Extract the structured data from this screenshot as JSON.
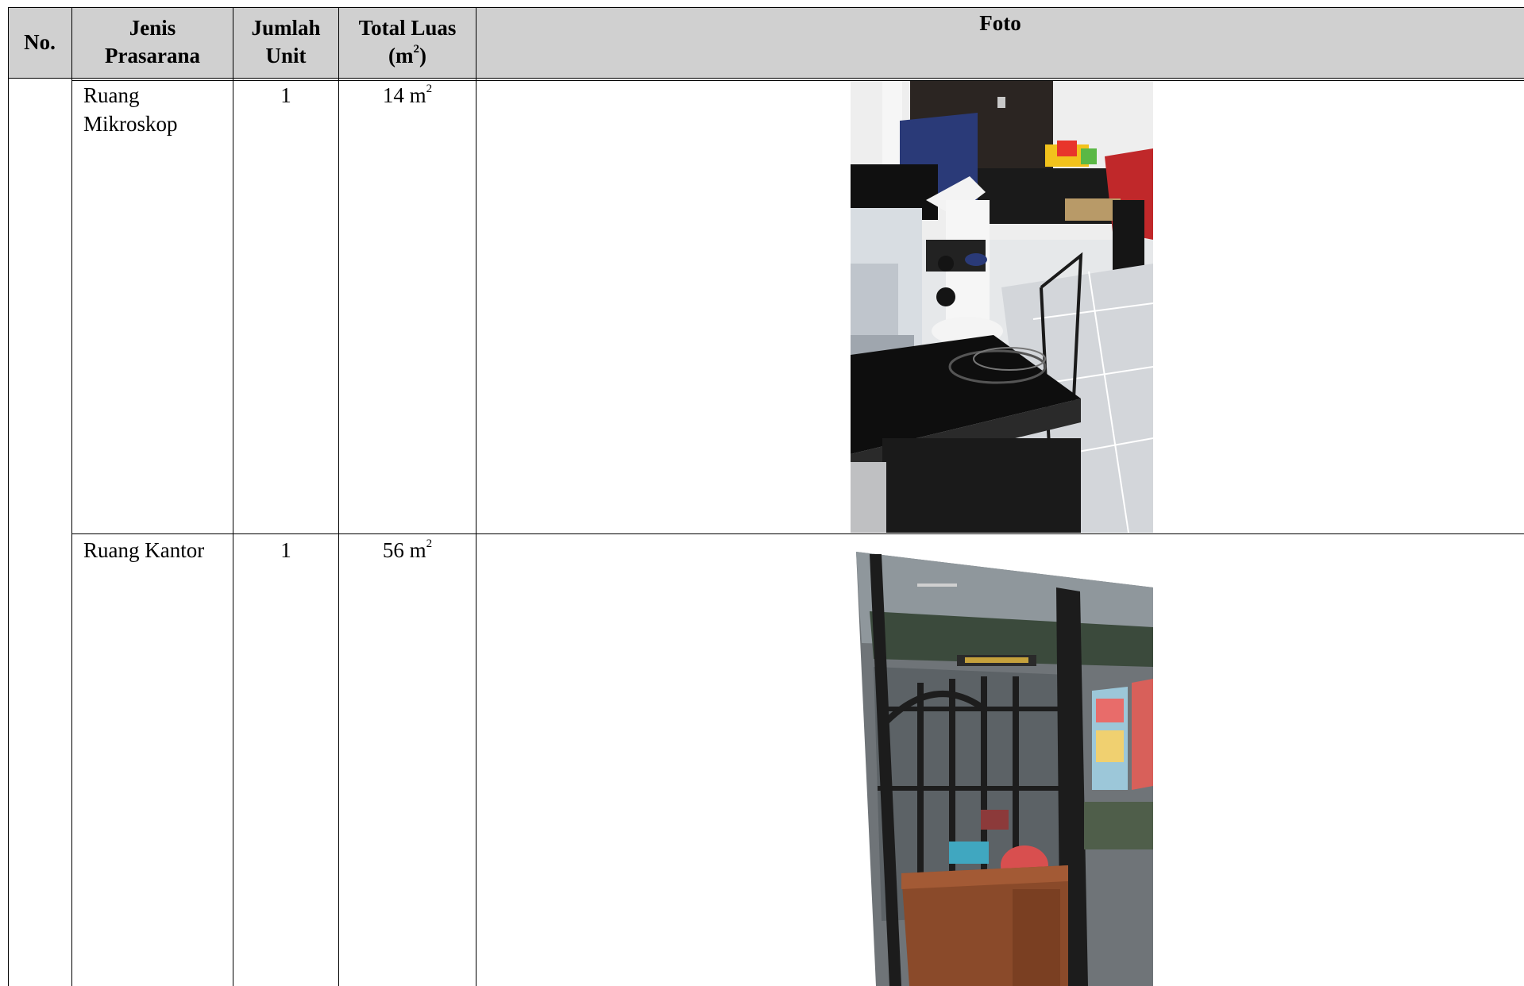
{
  "table": {
    "headers": {
      "no": "No.",
      "jenis_line1": "Jenis",
      "jenis_line2": "Prasarana",
      "jumlah_line1": "Jumlah",
      "jumlah_line2": "Unit",
      "luas_line1": "Total Luas",
      "luas_unit_base": "(m",
      "luas_unit_sup": "2",
      "luas_unit_end": ")",
      "foto": "Foto"
    },
    "rows": [
      {
        "jenis_line1": "Ruang",
        "jenis_line2": "Mikroskop",
        "jumlah": "1",
        "luas_value": "14 m",
        "luas_sup": "2"
      },
      {
        "jenis_line1": "Ruang Kantor",
        "jumlah": "1",
        "luas_value": "56 m",
        "luas_sup": "2"
      }
    ]
  }
}
